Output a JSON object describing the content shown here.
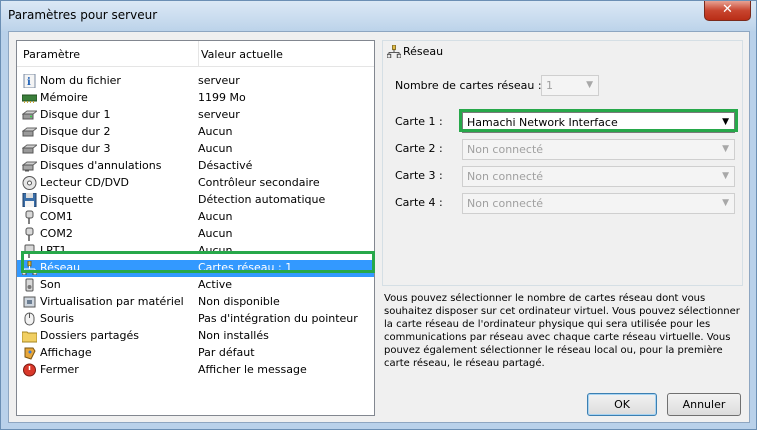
{
  "window": {
    "title": "Paramètres pour serveur",
    "close_label": "✕"
  },
  "list": {
    "header": {
      "param": "Paramètre",
      "value": "Valeur actuelle"
    },
    "rows": [
      {
        "name": "Nom du fichier",
        "value": "serveur",
        "icon": "info-icon"
      },
      {
        "name": "Mémoire",
        "value": "1199 Mo",
        "icon": "memory-icon"
      },
      {
        "name": "Disque dur 1",
        "value": "serveur",
        "icon": "hard-disk-icon"
      },
      {
        "name": "Disque dur 2",
        "value": "Aucun",
        "icon": "hard-disk-icon"
      },
      {
        "name": "Disque dur 3",
        "value": "Aucun",
        "icon": "hard-disk-icon"
      },
      {
        "name": "Disques d'annulations",
        "value": "Désactivé",
        "icon": "undo-disk-icon"
      },
      {
        "name": "Lecteur CD/DVD",
        "value": "Contrôleur secondaire",
        "icon": "cd-icon"
      },
      {
        "name": "Disquette",
        "value": "Détection automatique",
        "icon": "floppy-icon"
      },
      {
        "name": "COM1",
        "value": "Aucun",
        "icon": "com-port-icon"
      },
      {
        "name": "COM2",
        "value": "Aucun",
        "icon": "com-port-icon"
      },
      {
        "name": "LPT1",
        "value": "Aucun",
        "icon": "lpt-port-icon"
      },
      {
        "name": "Réseau",
        "value": "Cartes réseau : 1",
        "icon": "network-icon"
      },
      {
        "name": "Son",
        "value": "Active",
        "icon": "sound-icon"
      },
      {
        "name": "Virtualisation par matériel",
        "value": "Non disponible",
        "icon": "hardware-icon"
      },
      {
        "name": "Souris",
        "value": "Pas d'intégration du pointeur",
        "icon": "mouse-icon"
      },
      {
        "name": "Dossiers partagés",
        "value": "Non installés",
        "icon": "folder-icon"
      },
      {
        "name": "Affichage",
        "value": "Par défaut",
        "icon": "display-icon"
      },
      {
        "name": "Fermer",
        "value": "Afficher le message",
        "icon": "close-circle-icon"
      }
    ]
  },
  "network": {
    "title": "Réseau",
    "count_label": "Nombre de cartes réseau :",
    "count_value": "1",
    "cards": [
      {
        "label": "Carte 1 :",
        "value": "Hamachi Network Interface"
      },
      {
        "label": "Carte 2 :",
        "value": "Non connecté"
      },
      {
        "label": "Carte 3 :",
        "value": "Non connecté"
      },
      {
        "label": "Carte 4 :",
        "value": "Non connecté"
      }
    ]
  },
  "description": "Vous pouvez sélectionner le nombre de cartes réseau dont vous souhaitez disposer sur cet ordinateur virtuel. Vous pouvez sélectionner la carte réseau de l'ordinateur physique qui sera utilisée pour les communications par réseau avec chaque carte réseau virtuelle. Vous pouvez également sélectionner le réseau local ou, pour la première carte réseau, le réseau partagé.",
  "buttons": {
    "ok": "OK",
    "cancel": "Annuler"
  },
  "colors": {
    "selection": "#3399ff",
    "highlight": "#27a84a"
  }
}
